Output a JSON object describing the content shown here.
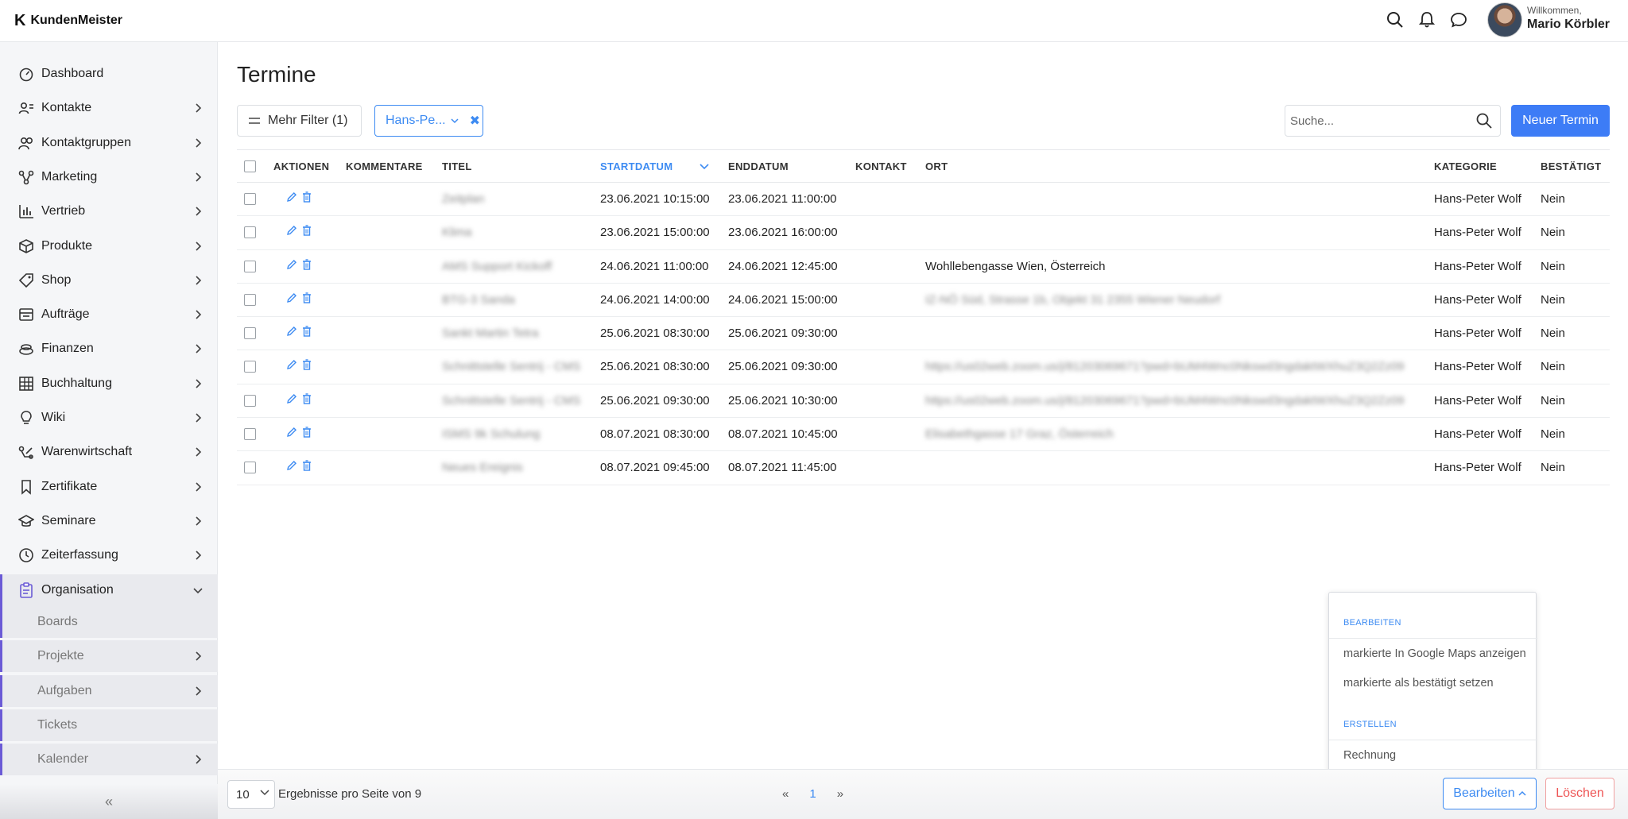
{
  "app": {
    "logo_mark": "K",
    "name": "KundenMeister"
  },
  "user": {
    "greeting": "Willkommen,",
    "name": "Mario Körbler"
  },
  "topbar": {
    "icons": [
      "search-icon",
      "bell-icon",
      "chat-icon"
    ]
  },
  "sidebar": {
    "items": [
      {
        "label": "Dashboard",
        "icon": "dashboard-icon",
        "has_children": false
      },
      {
        "label": "Kontakte",
        "icon": "contacts-icon",
        "has_children": true
      },
      {
        "label": "Kontaktgruppen",
        "icon": "groups-icon",
        "has_children": true
      },
      {
        "label": "Marketing",
        "icon": "marketing-icon",
        "has_children": true
      },
      {
        "label": "Vertrieb",
        "icon": "sales-chart-icon",
        "has_children": true
      },
      {
        "label": "Produkte",
        "icon": "box-icon",
        "has_children": true
      },
      {
        "label": "Shop",
        "icon": "tag-icon",
        "has_children": true
      },
      {
        "label": "Aufträge",
        "icon": "orders-icon",
        "has_children": true
      },
      {
        "label": "Finanzen",
        "icon": "finance-icon",
        "has_children": true
      },
      {
        "label": "Buchhaltung",
        "icon": "grid-icon",
        "has_children": true
      },
      {
        "label": "Wiki",
        "icon": "lightbulb-icon",
        "has_children": true
      },
      {
        "label": "Warenwirtschaft",
        "icon": "warehouse-icon",
        "has_children": true
      },
      {
        "label": "Zertifikate",
        "icon": "bookmark-icon",
        "has_children": true
      },
      {
        "label": "Seminare",
        "icon": "graduation-cap-icon",
        "has_children": true
      },
      {
        "label": "Zeiterfassung",
        "icon": "clock-icon",
        "has_children": true
      },
      {
        "label": "Organisation",
        "icon": "clipboard-icon",
        "has_children": true,
        "expanded": true
      }
    ],
    "sub_items": [
      {
        "label": "Boards",
        "has_children": false
      },
      {
        "label": "Projekte",
        "has_children": true
      },
      {
        "label": "Aufgaben",
        "has_children": true
      },
      {
        "label": "Tickets",
        "has_children": false
      },
      {
        "label": "Kalender",
        "has_children": true
      }
    ],
    "collapse_label": "«"
  },
  "page": {
    "title": "Termine",
    "filter_button": "Mehr Filter (1)",
    "filter_chip": "Hans-Pe...",
    "search_placeholder": "Suche...",
    "new_button": "Neuer Termin"
  },
  "table": {
    "columns": [
      "AKTIONEN",
      "KOMMENTARE",
      "TITEL",
      "STARTDATUM",
      "ENDDATUM",
      "KONTAKT",
      "ORT",
      "KATEGORIE",
      "BESTÄTIGT"
    ],
    "sorted_column": "STARTDATUM",
    "rows": [
      {
        "titel": "Zeitplan",
        "start": "23.06.2021 10:15:00",
        "ende": "23.06.2021 11:00:00",
        "ort": "",
        "ort_blurred": false,
        "kategorie": "Hans-Peter Wolf",
        "bestaetigt": "Nein"
      },
      {
        "titel": "Klima",
        "start": "23.06.2021 15:00:00",
        "ende": "23.06.2021 16:00:00",
        "ort": "",
        "ort_blurred": false,
        "kategorie": "Hans-Peter Wolf",
        "bestaetigt": "Nein"
      },
      {
        "titel": "AMS Support Kickoff",
        "start": "24.06.2021 11:00:00",
        "ende": "24.06.2021 12:45:00",
        "ort": "Wohllebengasse Wien, Österreich",
        "ort_blurred": false,
        "kategorie": "Hans-Peter Wolf",
        "bestaetigt": "Nein"
      },
      {
        "titel": "BTG-3 Sanda",
        "start": "24.06.2021 14:00:00",
        "ende": "24.06.2021 15:00:00",
        "ort": "IZ-NÖ Süd, Strasse 1b, Objekt 31 2355 Wiener Neudorf",
        "ort_blurred": true,
        "kategorie": "Hans-Peter Wolf",
        "bestaetigt": "Nein"
      },
      {
        "titel": "Sankt Martin Tetra",
        "start": "25.06.2021 08:30:00",
        "ende": "25.06.2021 09:30:00",
        "ort": "",
        "ort_blurred": false,
        "kategorie": "Hans-Peter Wolf",
        "bestaetigt": "Nein"
      },
      {
        "titel": "Schnittstelle Sentrij - CMS",
        "start": "25.06.2021 08:30:00",
        "ende": "25.06.2021 09:30:00",
        "ort": "https://us02web.zoom.us/j/81203069671?pwd=bUM4Wnc0Nkswd3ngdaktWXhuZ3Q2Zz09",
        "ort_blurred": true,
        "kategorie": "Hans-Peter Wolf",
        "bestaetigt": "Nein"
      },
      {
        "titel": "Schnittstelle Sentrij - CMS",
        "start": "25.06.2021 09:30:00",
        "ende": "25.06.2021 10:30:00",
        "ort": "https://us02web.zoom.us/j/81203069671?pwd=bUM4Wnc0Nkswd3ngdaktWXhuZ3Q2Zz09",
        "ort_blurred": true,
        "kategorie": "Hans-Peter Wolf",
        "bestaetigt": "Nein"
      },
      {
        "titel": "ISMS 9k Schulung",
        "start": "08.07.2021 08:30:00",
        "ende": "08.07.2021 10:45:00",
        "ort": "Elisabethgasse 17 Graz, Österreich",
        "ort_blurred": true,
        "kategorie": "Hans-Peter Wolf",
        "bestaetigt": "Nein"
      },
      {
        "titel": "Neues Ereignis",
        "start": "08.07.2021 09:45:00",
        "ende": "08.07.2021 11:45:00",
        "ort": "",
        "ort_blurred": false,
        "kategorie": "Hans-Peter Wolf",
        "bestaetigt": "Nein"
      }
    ]
  },
  "menu": {
    "section_edit": "BEARBEITEN",
    "edit_items": [
      "markierte In Google Maps anzeigen",
      "markierte als bestätigt setzen"
    ],
    "section_create": "ERSTELLEN",
    "create_items": [
      "Rechnung"
    ]
  },
  "footer": {
    "per_page": "10",
    "results_text": "Ergebnisse pro Seite von 9",
    "prev": "«",
    "current_page": "1",
    "next": "»",
    "edit_button": "Bearbeiten",
    "delete_button": "Löschen"
  },
  "colors": {
    "accent": "#3d8bf2",
    "primary_button": "#3d7cf6",
    "sidebar_active_border": "#6b5bd6",
    "danger": "#ee5555"
  }
}
